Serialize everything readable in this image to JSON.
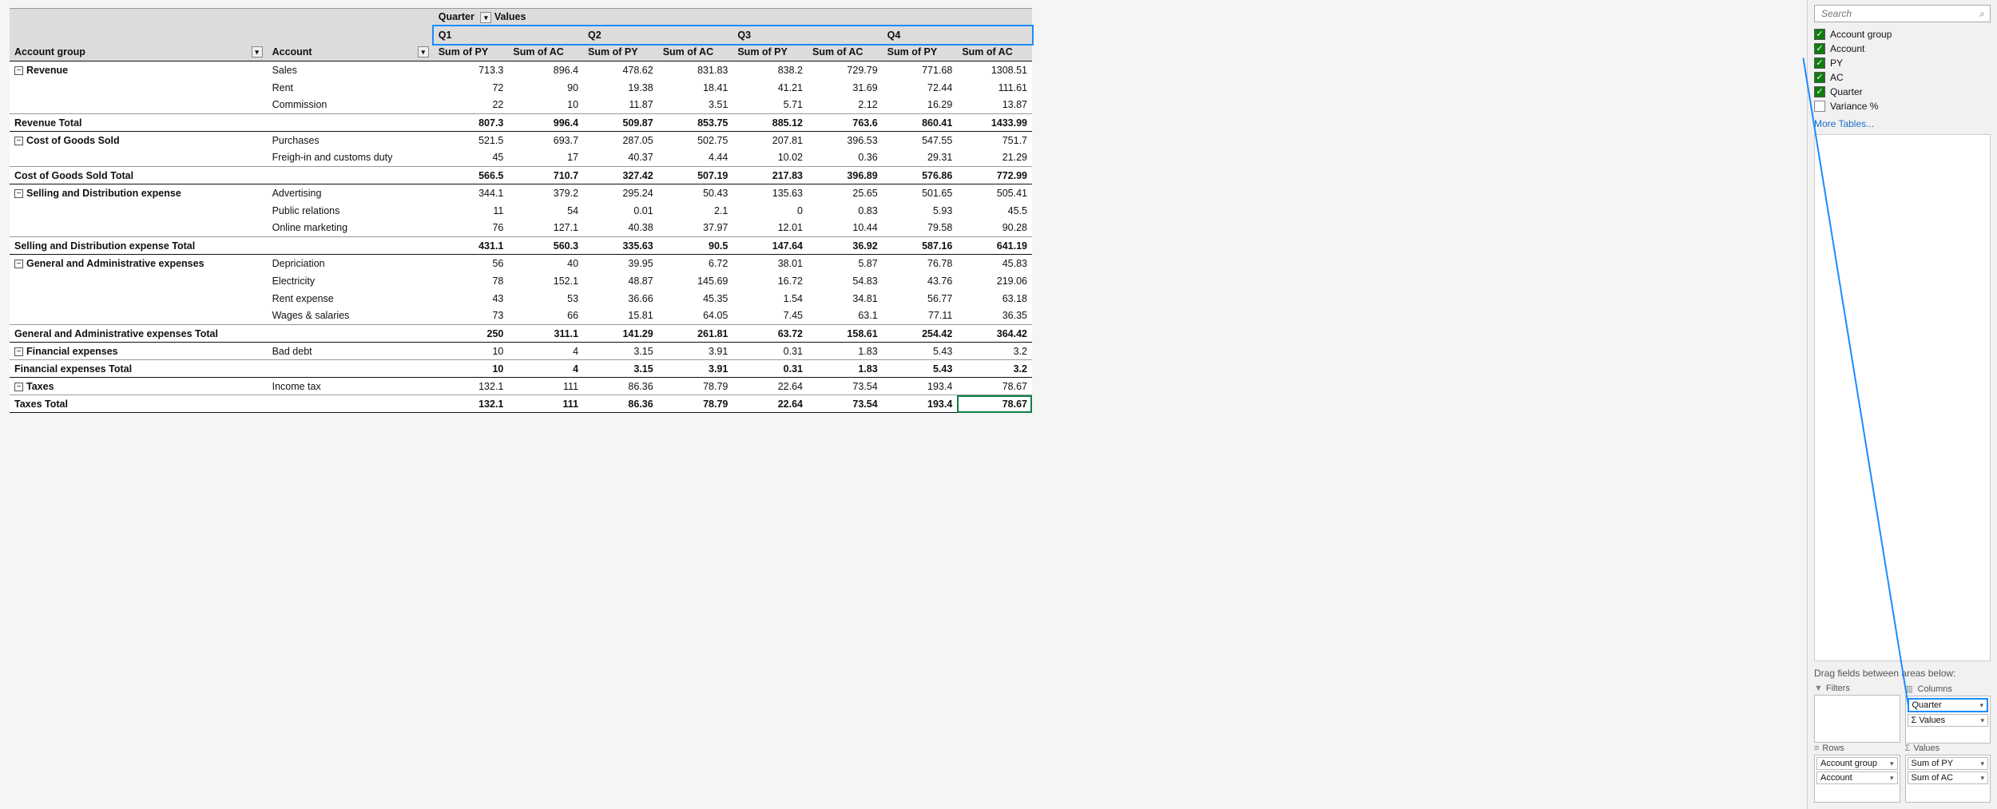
{
  "search_placeholder": "Search",
  "header": {
    "quarter_label": "Quarter",
    "values_label": "Values",
    "account_group": "Account group",
    "account": "Account",
    "quarters": [
      "Q1",
      "Q2",
      "Q3",
      "Q4"
    ],
    "sum_py": "Sum of PY",
    "sum_ac": "Sum of AC"
  },
  "groups": [
    {
      "name": "Revenue",
      "rows": [
        {
          "acct": "Sales",
          "v": [
            713.3,
            896.4,
            478.62,
            831.83,
            838.2,
            729.79,
            771.68,
            1308.51
          ]
        },
        {
          "acct": "Rent",
          "v": [
            72,
            90,
            19.38,
            18.41,
            41.21,
            31.69,
            72.44,
            111.61
          ]
        },
        {
          "acct": "Commission",
          "v": [
            22,
            10,
            11.87,
            3.51,
            5.71,
            2.12,
            16.29,
            13.87
          ]
        }
      ],
      "total_label": "Revenue Total",
      "total": [
        807.3,
        996.4,
        509.87,
        853.75,
        885.12,
        763.6,
        860.41,
        1433.99
      ]
    },
    {
      "name": "Cost of Goods Sold",
      "rows": [
        {
          "acct": "Purchases",
          "v": [
            521.5,
            693.7,
            287.05,
            502.75,
            207.81,
            396.53,
            547.55,
            751.7
          ]
        },
        {
          "acct": "Freigh-in and customs duty",
          "v": [
            45,
            17,
            40.37,
            4.44,
            10.02,
            0.36,
            29.31,
            21.29
          ]
        }
      ],
      "total_label": "Cost of Goods Sold Total",
      "total": [
        566.5,
        710.7,
        327.42,
        507.19,
        217.83,
        396.89,
        576.86,
        772.99
      ]
    },
    {
      "name": "Selling and Distribution expense",
      "rows": [
        {
          "acct": "Advertising",
          "v": [
            344.1,
            379.2,
            295.24,
            50.43,
            135.63,
            25.65,
            501.65,
            505.41
          ]
        },
        {
          "acct": "Public relations",
          "v": [
            11,
            54,
            0.01,
            2.1,
            0,
            0.83,
            5.93,
            45.5
          ]
        },
        {
          "acct": "Online marketing",
          "v": [
            76,
            127.1,
            40.38,
            37.97,
            12.01,
            10.44,
            79.58,
            90.28
          ]
        }
      ],
      "total_label": "Selling and Distribution expense Total",
      "total": [
        431.1,
        560.3,
        335.63,
        90.5,
        147.64,
        36.92,
        587.16,
        641.19
      ]
    },
    {
      "name": "General and Administrative expenses",
      "rows": [
        {
          "acct": "Depriciation",
          "v": [
            56,
            40,
            39.95,
            6.72,
            38.01,
            5.87,
            76.78,
            45.83
          ]
        },
        {
          "acct": "Electricity",
          "v": [
            78,
            152.1,
            48.87,
            145.69,
            16.72,
            54.83,
            43.76,
            219.06
          ]
        },
        {
          "acct": "Rent expense",
          "v": [
            43,
            53,
            36.66,
            45.35,
            1.54,
            34.81,
            56.77,
            63.18
          ]
        },
        {
          "acct": "Wages & salaries",
          "v": [
            73,
            66,
            15.81,
            64.05,
            7.45,
            63.1,
            77.11,
            36.35
          ]
        }
      ],
      "total_label": "General and Administrative expenses Total",
      "total": [
        250,
        311.1,
        141.29,
        261.81,
        63.72,
        158.61,
        254.42,
        364.42
      ]
    },
    {
      "name": "Financial expenses",
      "rows": [
        {
          "acct": "Bad debt",
          "v": [
            10,
            4,
            3.15,
            3.91,
            0.31,
            1.83,
            5.43,
            3.2
          ]
        }
      ],
      "total_label": "Financial expenses Total",
      "total": [
        10,
        4,
        3.15,
        3.91,
        0.31,
        1.83,
        5.43,
        3.2
      ]
    },
    {
      "name": "Taxes",
      "rows": [
        {
          "acct": "Income tax",
          "v": [
            132.1,
            111,
            86.36,
            78.79,
            22.64,
            73.54,
            193.4,
            78.67
          ]
        }
      ],
      "total_label": "Taxes Total",
      "total": [
        132.1,
        111,
        86.36,
        78.79,
        22.64,
        73.54,
        193.4,
        78.67
      ]
    }
  ],
  "fields": [
    {
      "label": "Account group",
      "checked": true
    },
    {
      "label": "Account",
      "checked": true
    },
    {
      "label": "PY",
      "checked": true
    },
    {
      "label": "AC",
      "checked": true
    },
    {
      "label": "Quarter",
      "checked": true
    },
    {
      "label": "Variance %",
      "checked": false
    }
  ],
  "more_tables": "More Tables...",
  "drag_hint": "Drag fields between areas below:",
  "area_labels": {
    "filters": "Filters",
    "columns": "Columns",
    "rows": "Rows",
    "values": "Values",
    "sigma_values": "Σ Values"
  },
  "area_columns": [
    "Quarter",
    "Σ Values"
  ],
  "area_rows": [
    "Account group",
    "Account"
  ],
  "area_values": [
    "Sum of PY",
    "Sum of AC"
  ]
}
